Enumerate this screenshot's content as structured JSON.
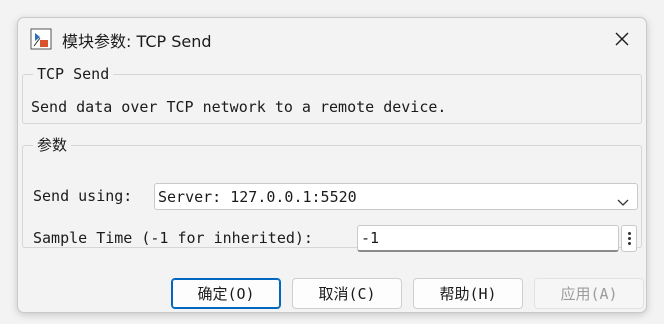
{
  "window": {
    "title": "模块参数: TCP Send"
  },
  "block_info": {
    "group_title": "TCP Send",
    "description": "Send data over TCP network to a remote device."
  },
  "params": {
    "group_title": "参数",
    "send_using_label": "Send using:",
    "send_using_value": "Server: 127.0.0.1:5520",
    "sample_time_label": "Sample Time (-1 for inherited):",
    "sample_time_value": "-1"
  },
  "buttons": {
    "ok": "确定(O)",
    "cancel": "取消(C)",
    "help": "帮助(H)",
    "apply": "应用(A)"
  },
  "colors": {
    "accent": "#0067c0",
    "background": "#f3f3f3",
    "border": "#c9c9c9"
  },
  "icons": {
    "app": "simulink-block-icon",
    "close": "close-icon",
    "dropdown": "chevron-down-icon",
    "options": "kebab-menu-icon"
  }
}
